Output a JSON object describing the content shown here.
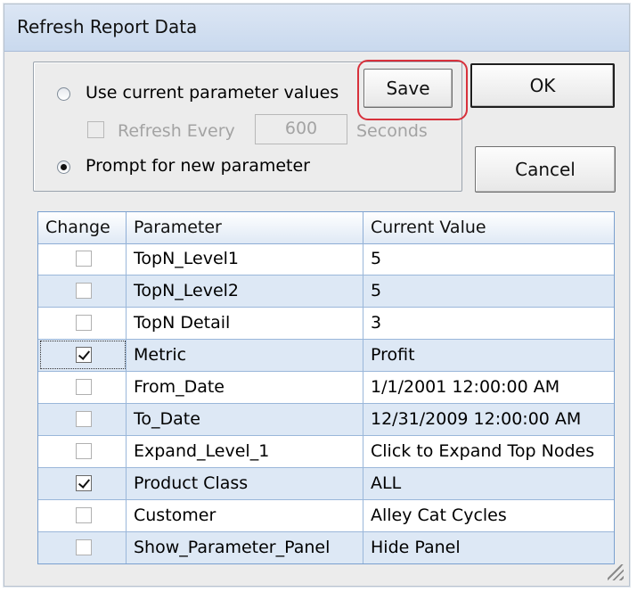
{
  "window": {
    "title": "Refresh Report Data"
  },
  "options": {
    "use_current_label": "Use current parameter values",
    "use_current_selected": false,
    "refresh_every_label": "Refresh Every",
    "refresh_every_checked": false,
    "refresh_value": "600",
    "seconds_label": "Seconds",
    "prompt_label": "Prompt for new parameter",
    "prompt_selected": true
  },
  "buttons": {
    "save": "Save",
    "ok": "OK",
    "cancel": "Cancel"
  },
  "colors": {
    "highlight": "#d8313c",
    "grid_alt_row": "#dde8f5"
  },
  "grid": {
    "columns": [
      "Change",
      "Parameter",
      "Current Value"
    ],
    "rows": [
      {
        "checked": false,
        "parameter": "TopN_Level1",
        "value": "5"
      },
      {
        "checked": false,
        "parameter": "TopN_Level2",
        "value": "5"
      },
      {
        "checked": false,
        "parameter": "TopN Detail",
        "value": "3"
      },
      {
        "checked": true,
        "parameter": "Metric",
        "value": "Profit"
      },
      {
        "checked": false,
        "parameter": "From_Date",
        "value": "1/1/2001 12:00:00 AM"
      },
      {
        "checked": false,
        "parameter": "To_Date",
        "value": "12/31/2009 12:00:00 AM"
      },
      {
        "checked": false,
        "parameter": "Expand_Level_1",
        "value": "Click to Expand Top Nodes"
      },
      {
        "checked": true,
        "parameter": "Product Class",
        "value": "ALL"
      },
      {
        "checked": false,
        "parameter": "Customer",
        "value": "Alley Cat Cycles"
      },
      {
        "checked": false,
        "parameter": "Show_Parameter_Panel",
        "value": "Hide Panel"
      }
    ]
  }
}
